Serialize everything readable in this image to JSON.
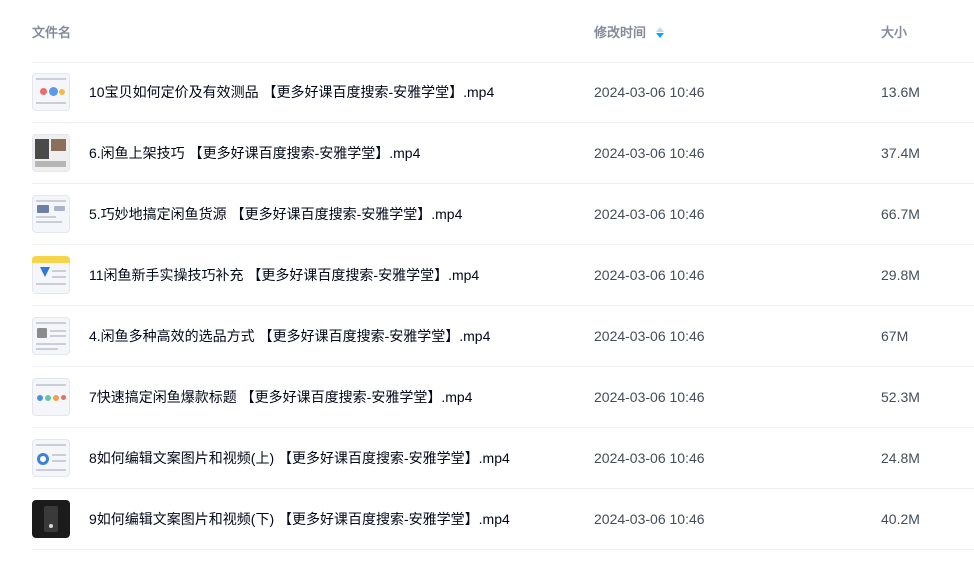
{
  "header": {
    "name_label": "文件名",
    "time_label": "修改时间",
    "size_label": "大小",
    "sort_icon": "sort-desc-icon",
    "sort_active_color": "#06a7ff"
  },
  "files": [
    {
      "name": "10宝贝如何定价及有效测品 【更多好课百度搜索-安雅学堂】.mp4",
      "modified": "2024-03-06 10:46",
      "size": "13.6M",
      "thumbnail": "video-thumbnail-icon"
    },
    {
      "name": "6.闲鱼上架技巧 【更多好课百度搜索-安雅学堂】.mp4",
      "modified": "2024-03-06 10:46",
      "size": "37.4M",
      "thumbnail": "video-thumbnail-icon"
    },
    {
      "name": "5.巧妙地搞定闲鱼货源 【更多好课百度搜索-安雅学堂】.mp4",
      "modified": "2024-03-06 10:46",
      "size": "66.7M",
      "thumbnail": "video-thumbnail-icon"
    },
    {
      "name": "11闲鱼新手实操技巧补充 【更多好课百度搜索-安雅学堂】.mp4",
      "modified": "2024-03-06 10:46",
      "size": "29.8M",
      "thumbnail": "video-thumbnail-icon"
    },
    {
      "name": "4.闲鱼多种高效的选品方式 【更多好课百度搜索-安雅学堂】.mp4",
      "modified": "2024-03-06 10:46",
      "size": "67M",
      "thumbnail": "video-thumbnail-icon"
    },
    {
      "name": "7快速搞定闲鱼爆款标题 【更多好课百度搜索-安雅学堂】.mp4",
      "modified": "2024-03-06 10:46",
      "size": "52.3M",
      "thumbnail": "video-thumbnail-icon"
    },
    {
      "name": "8如何编辑文案图片和视频(上) 【更多好课百度搜索-安雅学堂】.mp4",
      "modified": "2024-03-06 10:46",
      "size": "24.8M",
      "thumbnail": "video-thumbnail-icon"
    },
    {
      "name": "9如何编辑文案图片和视频(下) 【更多好课百度搜索-安雅学堂】.mp4",
      "modified": "2024-03-06 10:46",
      "size": "40.2M",
      "thumbnail": "video-thumbnail-icon"
    }
  ]
}
